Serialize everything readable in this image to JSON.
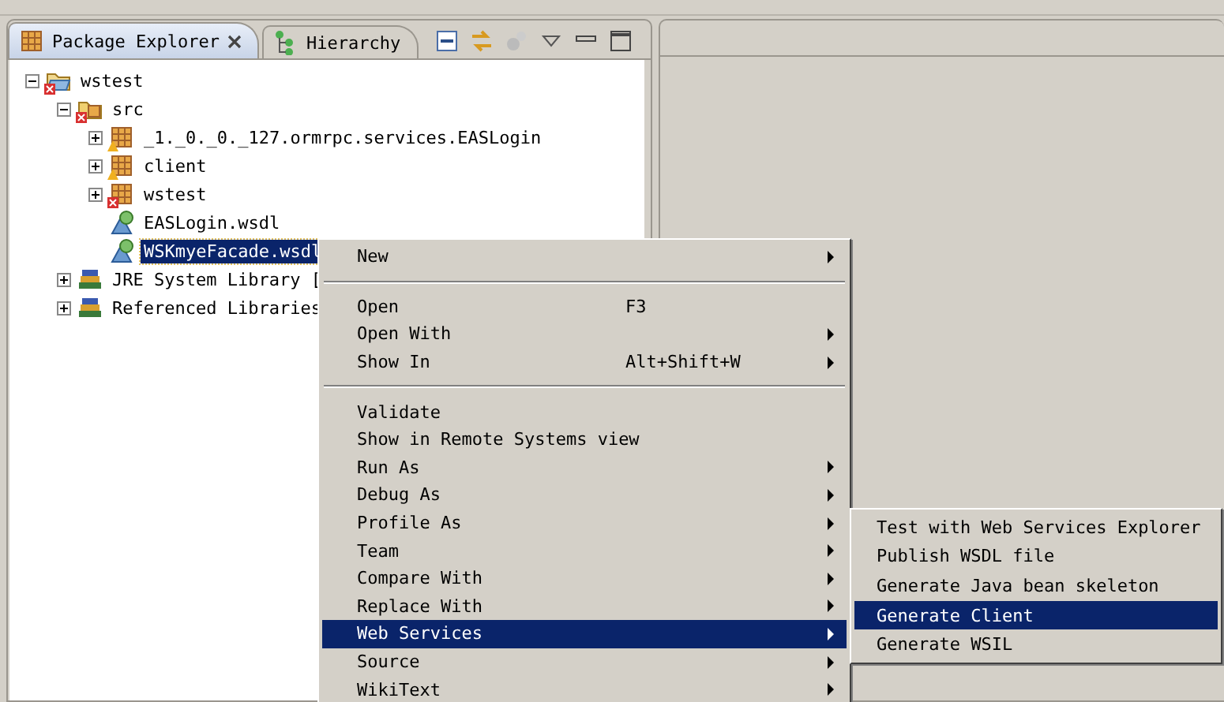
{
  "left_view": {
    "tabs": [
      {
        "label": "Package Explorer",
        "selected": true,
        "closable": true,
        "kind": "package"
      },
      {
        "label": "Hierarchy",
        "selected": false,
        "closable": false,
        "kind": "hierarchy"
      }
    ]
  },
  "tree": [
    {
      "label": "wstest",
      "kind": "project",
      "error": true,
      "warning": false,
      "expanded": true,
      "selected": false,
      "children": [
        {
          "label": "src",
          "kind": "source-folder",
          "error": true,
          "warning": false,
          "expanded": true,
          "selected": false,
          "children": [
            {
              "label": "_1._0._0._127.ormrpc.services.EASLogin",
              "kind": "package",
              "error": false,
              "warning": true,
              "expanded": false,
              "selected": false
            },
            {
              "label": "client",
              "kind": "package",
              "error": false,
              "warning": true,
              "expanded": false,
              "selected": false
            },
            {
              "label": "wstest",
              "kind": "package",
              "error": true,
              "warning": false,
              "expanded": false,
              "selected": false
            },
            {
              "label": "EASLogin.wsdl",
              "kind": "wsdl",
              "error": false,
              "warning": false,
              "selected": false
            },
            {
              "label": "WSKmyeFacade.wsdl",
              "kind": "wsdl",
              "error": false,
              "warning": false,
              "selected": true
            }
          ]
        },
        {
          "label": "JRE System Library [",
          "kind": "library",
          "error": false,
          "warning": false,
          "expanded": false,
          "selected": false
        },
        {
          "label": "Referenced Libraries",
          "kind": "library",
          "error": false,
          "warning": false,
          "expanded": false,
          "selected": false
        }
      ]
    }
  ],
  "context_menu": [
    {
      "kind": "item",
      "label": "New",
      "submenu": true,
      "selected": false
    },
    {
      "kind": "separator"
    },
    {
      "kind": "item",
      "label": "Open",
      "shortcut": "F3",
      "submenu": false,
      "selected": false
    },
    {
      "kind": "item",
      "label": "Open With",
      "submenu": true,
      "selected": false
    },
    {
      "kind": "item",
      "label": "Show In",
      "shortcut": "Alt+Shift+W",
      "submenu": true,
      "selected": false
    },
    {
      "kind": "separator"
    },
    {
      "kind": "item",
      "label": "Validate",
      "submenu": false,
      "selected": false
    },
    {
      "kind": "item",
      "label": "Show in Remote Systems view",
      "submenu": false,
      "selected": false
    },
    {
      "kind": "item",
      "label": "Run As",
      "submenu": true,
      "selected": false
    },
    {
      "kind": "item",
      "label": "Debug As",
      "submenu": true,
      "selected": false
    },
    {
      "kind": "item",
      "label": "Profile As",
      "submenu": true,
      "selected": false
    },
    {
      "kind": "item",
      "label": "Team",
      "submenu": true,
      "selected": false
    },
    {
      "kind": "item",
      "label": "Compare With",
      "submenu": true,
      "selected": false
    },
    {
      "kind": "item",
      "label": "Replace With",
      "submenu": true,
      "selected": false
    },
    {
      "kind": "item",
      "label": "Web Services",
      "submenu": true,
      "selected": true
    },
    {
      "kind": "item",
      "label": "Source",
      "submenu": true,
      "selected": false
    },
    {
      "kind": "item",
      "label": "WikiText",
      "submenu": true,
      "selected": false
    }
  ],
  "submenu": [
    {
      "label": "Test with Web Services Explorer",
      "selected": false
    },
    {
      "label": "Publish WSDL file",
      "selected": false
    },
    {
      "label": "Generate Java bean skeleton",
      "selected": false
    },
    {
      "label": "Generate Client",
      "selected": true
    },
    {
      "label": "Generate WSIL",
      "selected": false
    }
  ]
}
